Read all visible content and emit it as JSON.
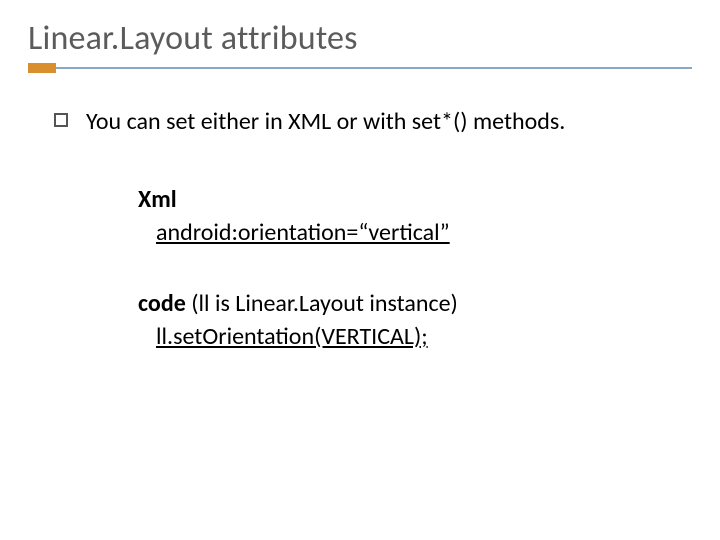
{
  "title": "Linear.Layout attributes",
  "bullet": "You can set either in XML or with set*() methods.",
  "xml": {
    "label": "Xml",
    "line": "android:orientation=“vertical”"
  },
  "code": {
    "label": "code",
    "note": " (ll is Linear.Layout instance)",
    "line": "ll.setOrientation(VERTICAL);"
  }
}
